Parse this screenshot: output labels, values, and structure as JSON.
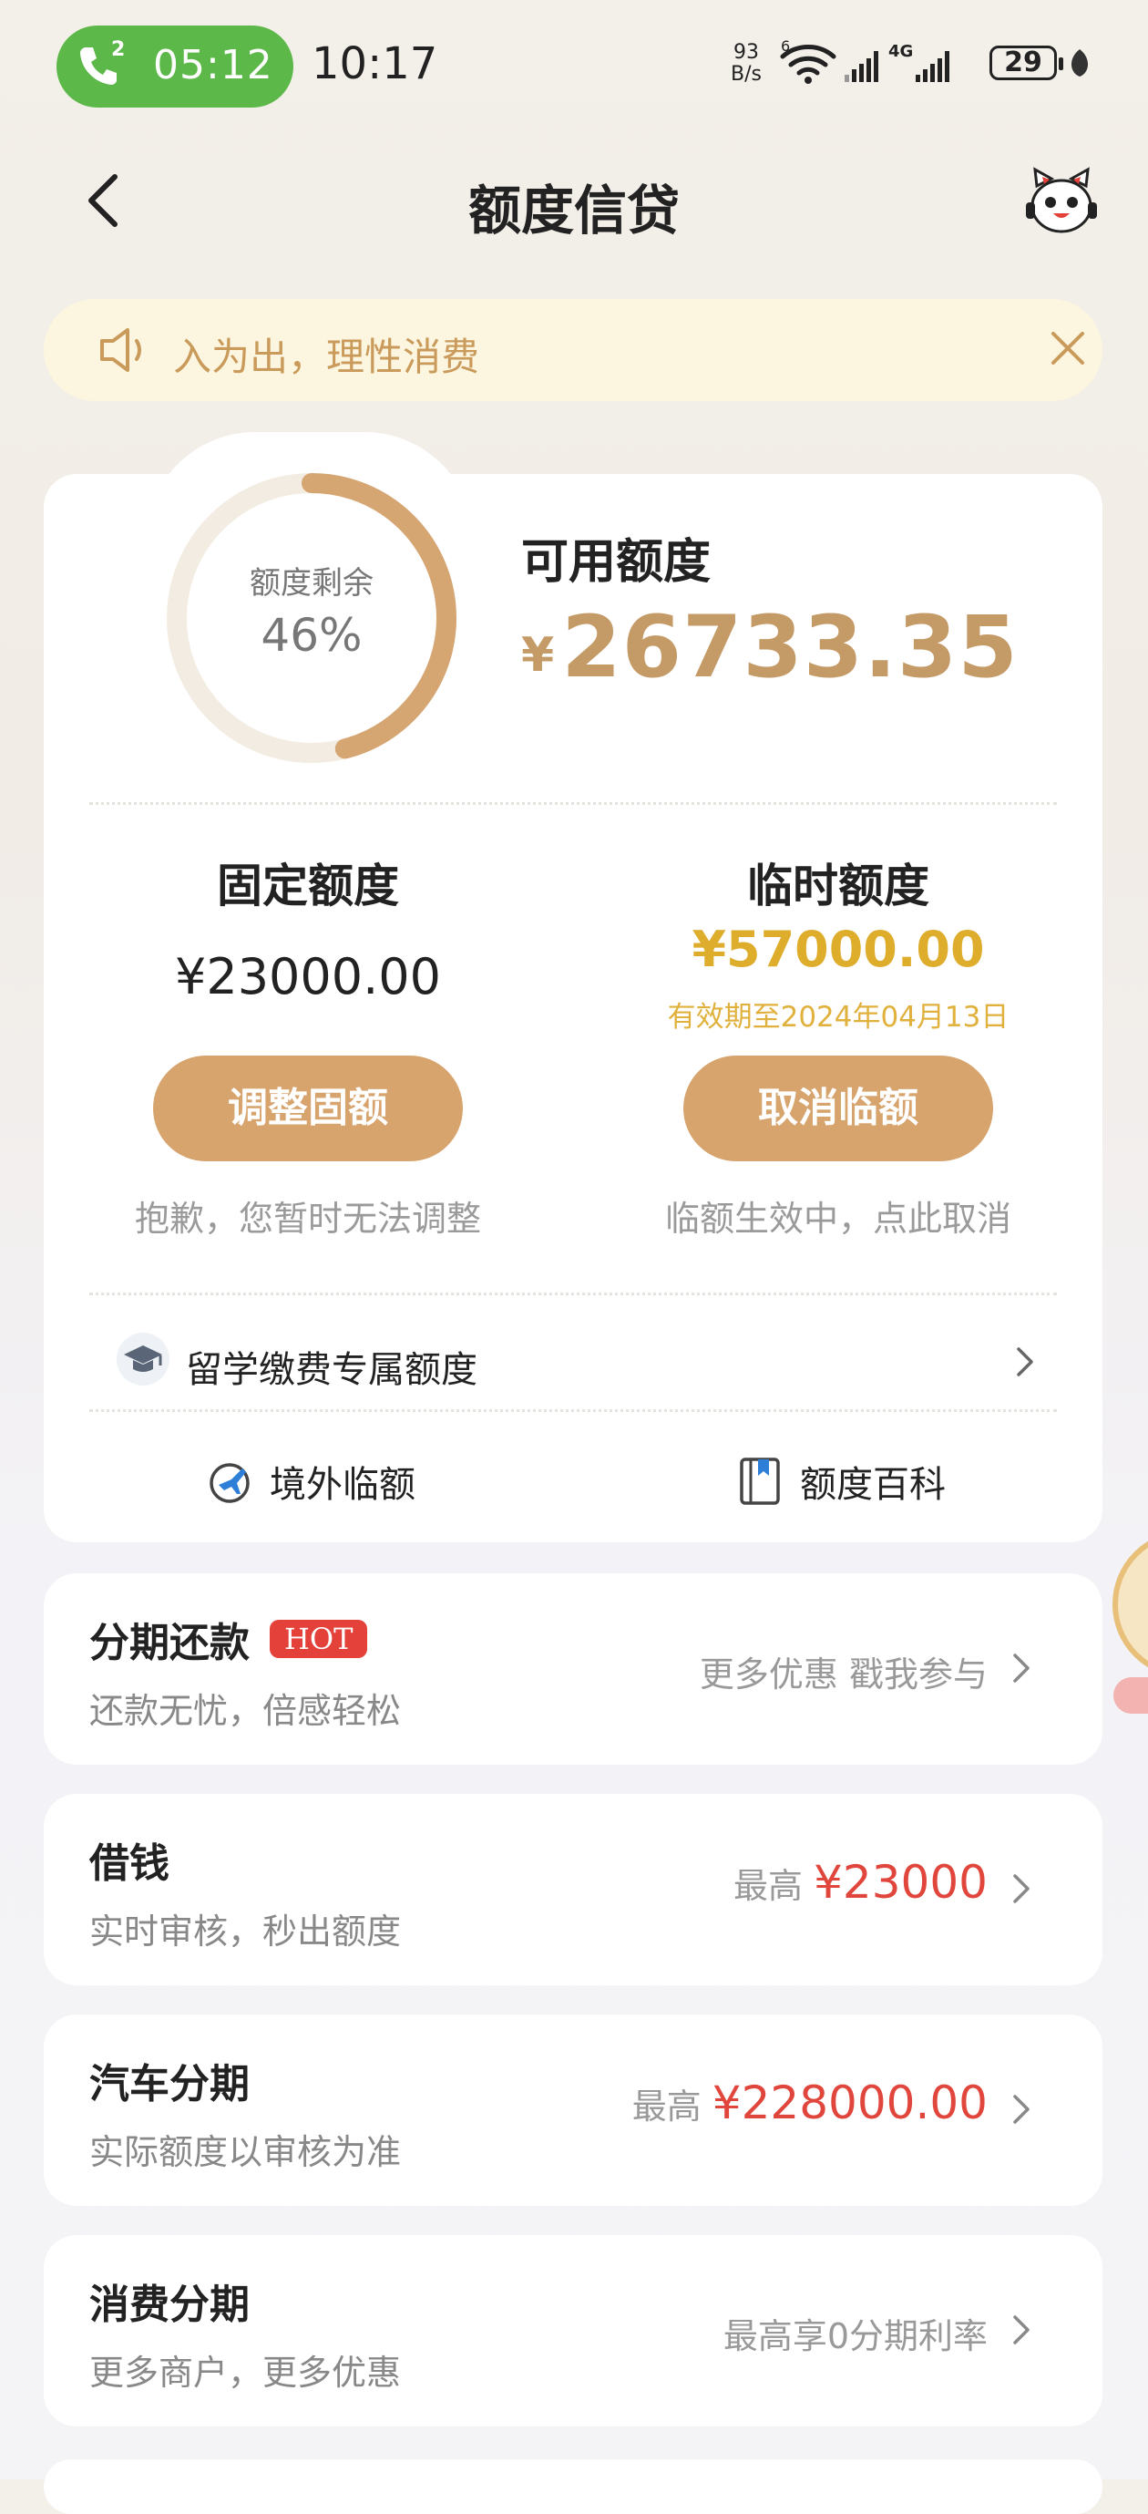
{
  "status_bar": {
    "call_count": "2",
    "call_timer": "05:12",
    "time": "10:17",
    "net_speed_value": "93",
    "net_speed_unit": "B/s",
    "battery": "29",
    "network": "4G",
    "wifi": "6"
  },
  "header": {
    "title": "额度信贷"
  },
  "notice": {
    "text": "入为出，理性消费"
  },
  "credit": {
    "ring_label": "额度剩余",
    "ring_percent_text": "46%",
    "remaining_fraction": 0.46,
    "available_label": "可用额度",
    "currency": "¥",
    "available_amount": "26733.35",
    "fixed": {
      "title": "固定额度",
      "amount": "¥23000.00",
      "button": "调整固额",
      "note": "抱歉，您暂时无法调整"
    },
    "temporary": {
      "title": "临时额度",
      "amount": "¥57000.00",
      "valid_until": "有效期至2024年04月13日",
      "button": "取消临额",
      "note": "临额生效中，点此取消"
    },
    "study_abroad": "留学缴费专属额度",
    "overseas": "境外临额",
    "encyclopedia": "额度百科"
  },
  "list": [
    {
      "title": "分期还款",
      "badge": "HOT",
      "subtitle": "还款无忧，倍感轻松",
      "right_text": "更多优惠 戳我参与",
      "right_prefix": "",
      "right_amount": ""
    },
    {
      "title": "借钱",
      "badge": "",
      "subtitle": "实时审核，秒出额度",
      "right_text": "",
      "right_prefix": "最高",
      "right_amount": "¥23000"
    },
    {
      "title": "汽车分期",
      "badge": "",
      "subtitle": "实际额度以审核为准",
      "right_text": "",
      "right_prefix": "最高",
      "right_amount": "¥228000.00"
    },
    {
      "title": "消费分期",
      "badge": "",
      "subtitle": "更多商户，更多优惠",
      "right_text": "最高享0分期利率",
      "right_prefix": "",
      "right_amount": ""
    }
  ],
  "colors": {
    "accent_gold": "#c49a66",
    "button_gold": "#d7a46e",
    "temp_yellow": "#dfad2c",
    "price_red": "#e0463c",
    "call_green": "#5cb848"
  }
}
